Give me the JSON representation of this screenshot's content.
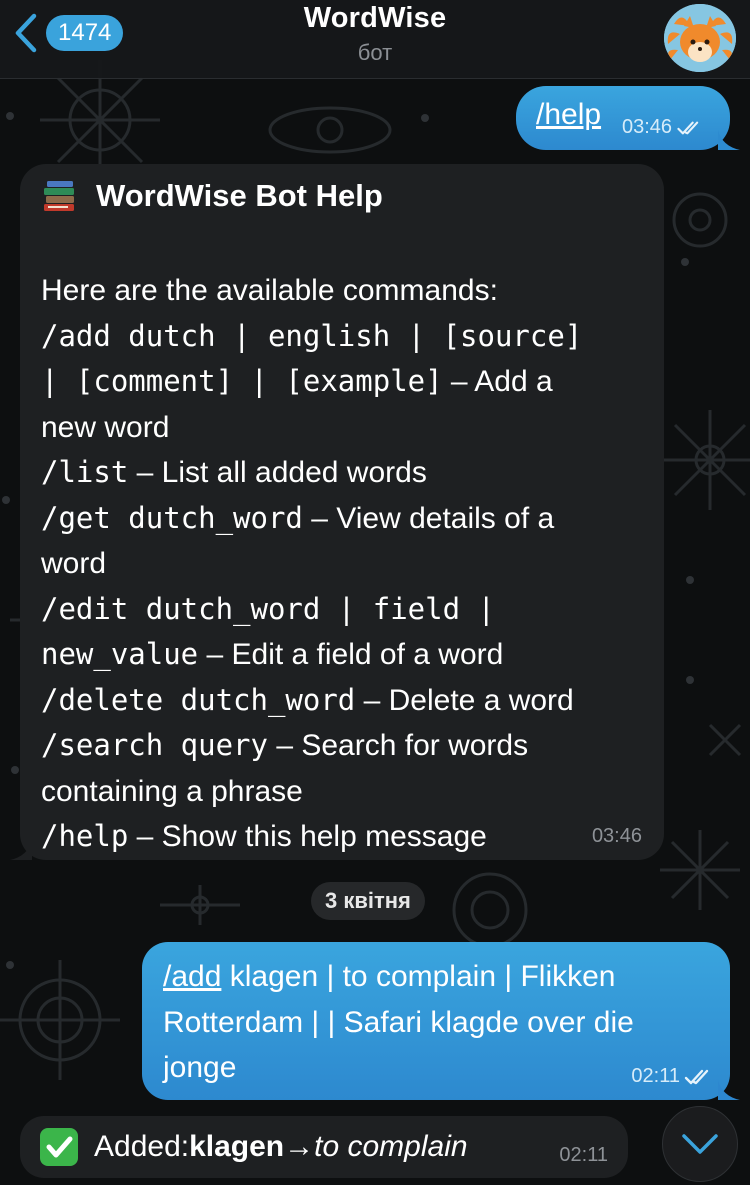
{
  "header": {
    "unread_count": "1474",
    "title": "WordWise",
    "subtitle": "бот"
  },
  "messages": {
    "help_command": {
      "text": "/help",
      "time": "03:46"
    },
    "help_reply": {
      "title": "WordWise Bot Help",
      "lines": [
        {
          "cmd": "",
          "desc": "Here are the available commands:"
        },
        {
          "cmd": "/add dutch | english | [source]",
          "desc": ""
        },
        {
          "cmd": "| [comment] | [example]",
          "desc": " – Add a"
        },
        {
          "cmd": "",
          "desc": "new word"
        },
        {
          "cmd": "/list",
          "desc": " – List all added words"
        },
        {
          "cmd": "/get dutch_word",
          "desc": " – View details of a"
        },
        {
          "cmd": "",
          "desc": "word"
        },
        {
          "cmd": "/edit dutch_word | field |",
          "desc": ""
        },
        {
          "cmd": "new_value",
          "desc": " – Edit a field of a word"
        },
        {
          "cmd": "/delete dutch_word",
          "desc": " – Delete a word"
        },
        {
          "cmd": "/search query",
          "desc": " – Search for words"
        },
        {
          "cmd": "",
          "desc": "containing a phrase"
        },
        {
          "cmd": "/help",
          "desc": " – Show this help message"
        }
      ],
      "time": "03:46"
    },
    "date_separator": "3 квітня",
    "add_command": {
      "cmd": "/add",
      "line1_rest": " klagen | to complain | Flikken",
      "line2": "Rotterdam  | | Safari klagde over die",
      "line3": "jonge",
      "time": "02:11"
    },
    "added_reply": {
      "prefix": "Added: ",
      "word": "klagen",
      "arrow": " → ",
      "translation": "to complain",
      "time": "02:11"
    }
  },
  "colors": {
    "outgoing_bubble": "#3aa5de",
    "incoming_bubble": "#1e2022",
    "badge": "#3aa3dc",
    "background": "#0d0f10"
  },
  "icons": [
    "back-chevron-icon",
    "avatar",
    "books-icon",
    "double-check-icon",
    "check-mark-emoji-icon",
    "chevron-down-icon"
  ]
}
